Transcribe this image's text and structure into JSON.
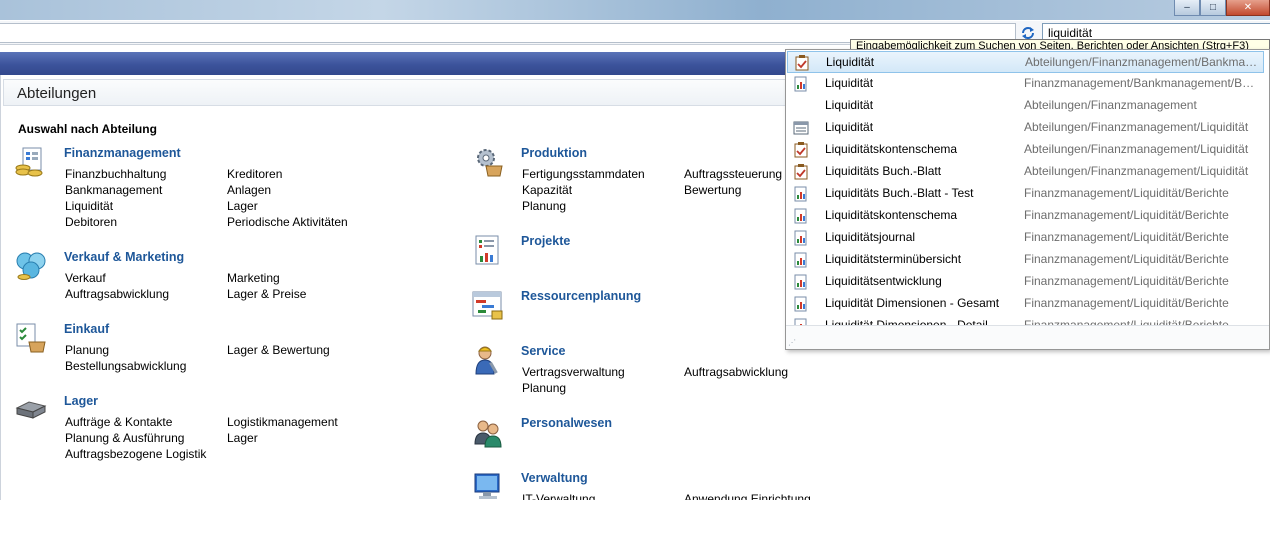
{
  "window": {
    "minimize_glyph": "–",
    "maximize_glyph": "□",
    "close_glyph": "✕"
  },
  "search": {
    "value": "liquidität",
    "tooltip": "Eingabemöglichkeit zum Suchen von Seiten, Berichten oder Ansichten (Strg+F3)"
  },
  "page": {
    "title": "Abteilungen",
    "subtitle": "Auswahl nach Abteilung"
  },
  "categories": [
    {
      "title": "Finanzmanagement",
      "icon": "finance-icon",
      "col1": [
        "Finanzbuchhaltung",
        "Bankmanagement",
        "Liquidität",
        "Debitoren"
      ],
      "col2": [
        "Kreditoren",
        "Anlagen",
        "Lager",
        "Periodische Aktivitäten"
      ]
    },
    {
      "title": "Verkauf & Marketing",
      "icon": "sales-icon",
      "col1": [
        "Verkauf",
        "Auftragsabwicklung"
      ],
      "col2": [
        "Marketing",
        "Lager & Preise"
      ]
    },
    {
      "title": "Einkauf",
      "icon": "purchase-icon",
      "col1": [
        "Planung",
        "Bestellungsabwicklung"
      ],
      "col2": [
        "Lager & Bewertung"
      ]
    },
    {
      "title": "Lager",
      "icon": "warehouse-icon",
      "col1": [
        "Aufträge & Kontakte",
        "Planung & Ausführung",
        "Auftragsbezogene Logistik"
      ],
      "col2": [
        "Logistikmanagement",
        "Lager"
      ]
    },
    {
      "title": "Produktion",
      "icon": "production-icon",
      "col1": [
        "Fertigungsstammdaten",
        "Kapazität",
        "Planung"
      ],
      "col2": [
        "Auftragssteuerung",
        "Bewertung"
      ]
    },
    {
      "title": "Projekte",
      "icon": "projects-icon",
      "col1": [],
      "col2": []
    },
    {
      "title": "Ressourcenplanung",
      "icon": "resource-icon",
      "col1": [],
      "col2": []
    },
    {
      "title": "Service",
      "icon": "service-icon",
      "col1": [
        "Vertragsverwaltung",
        "Planung"
      ],
      "col2": [
        "Auftragsabwicklung"
      ]
    },
    {
      "title": "Personalwesen",
      "icon": "hr-icon",
      "col1": [],
      "col2": []
    },
    {
      "title": "Verwaltung",
      "icon": "admin-icon",
      "col1": [
        "IT-Verwaltung"
      ],
      "col2": [
        "Anwendung Einrichtung"
      ]
    }
  ],
  "results": [
    {
      "name": "Liquidität",
      "path": "Abteilungen/Finanzmanagement/Bankmanagement",
      "icon": "task-icon"
    },
    {
      "name": "Liquidität",
      "path": "Finanzmanagement/Bankmanagement/Berichte",
      "icon": "report-icon"
    },
    {
      "name": "Liquidität",
      "path": "Abteilungen/Finanzmanagement",
      "icon": "none"
    },
    {
      "name": "Liquidität",
      "path": "Abteilungen/Finanzmanagement/Liquidität",
      "icon": "list-icon"
    },
    {
      "name": "Liquiditätskontenschema",
      "path": "Abteilungen/Finanzmanagement/Liquidität",
      "icon": "task-icon"
    },
    {
      "name": "Liquiditäts Buch.-Blatt",
      "path": "Abteilungen/Finanzmanagement/Liquidität",
      "icon": "task-icon"
    },
    {
      "name": "Liquiditäts Buch.-Blatt - Test",
      "path": "Finanzmanagement/Liquidität/Berichte",
      "icon": "report-icon"
    },
    {
      "name": "Liquiditätskontenschema",
      "path": "Finanzmanagement/Liquidität/Berichte",
      "icon": "report-icon"
    },
    {
      "name": "Liquiditätsjournal",
      "path": "Finanzmanagement/Liquidität/Berichte",
      "icon": "report-icon"
    },
    {
      "name": "Liquiditätsterminübersicht",
      "path": "Finanzmanagement/Liquidität/Berichte",
      "icon": "report-icon"
    },
    {
      "name": "Liquiditätsentwicklung",
      "path": "Finanzmanagement/Liquidität/Berichte",
      "icon": "report-icon"
    },
    {
      "name": "Liquidität Dimensionen -  Gesamt",
      "path": "Finanzmanagement/Liquidität/Berichte",
      "icon": "report-icon"
    },
    {
      "name": "Liquidität Dimensionen - Detail",
      "path": "Finanzmanagement/Liquidität/Berichte",
      "icon": "report-icon"
    }
  ]
}
